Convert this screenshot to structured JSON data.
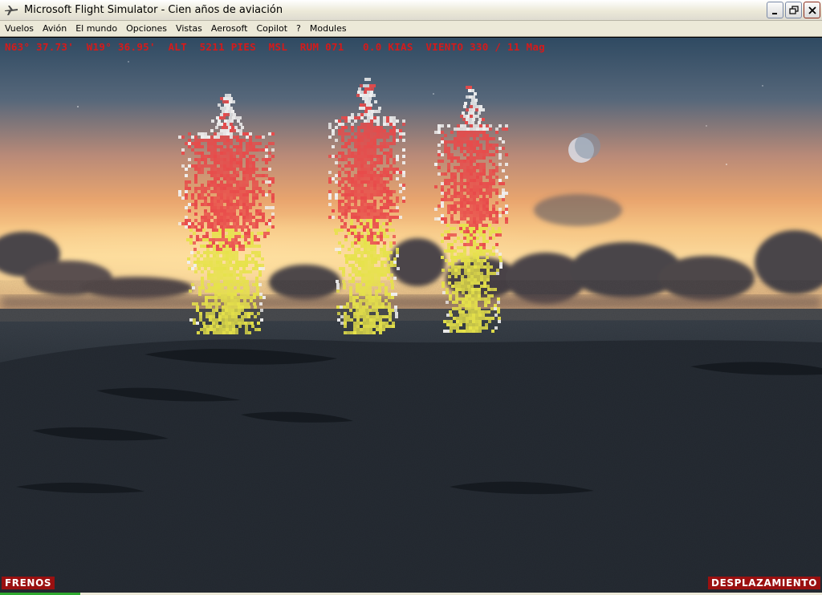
{
  "window": {
    "title": "Microsoft Flight Simulator - Cien años de aviación",
    "app_icon": "airplane-icon",
    "controls": [
      "minimize-icon",
      "restore-icon",
      "close-icon"
    ]
  },
  "menu": {
    "items": [
      "Vuelos",
      "Avión",
      "El mundo",
      "Opciones",
      "Vistas",
      "Aerosoft",
      "Copilot",
      "?",
      "Modules"
    ]
  },
  "hud": {
    "text": "N63° 37.73'  W19° 36.95'  ALT  5211 PIES  MSL  RUM 071   0.0 KIAS  VIENTO 330 / 11 Mag",
    "color": "#d61a1a"
  },
  "status": {
    "brakes": "FRENOS",
    "slew": "DESPLAZAMIENTO",
    "badge_color": "#9a1010"
  },
  "colors": {
    "menu_bg": "#ece9d8",
    "flame_red": "#e84a4a",
    "flame_yellow": "#e6e24a",
    "flame_white": "#f0f0f0"
  }
}
